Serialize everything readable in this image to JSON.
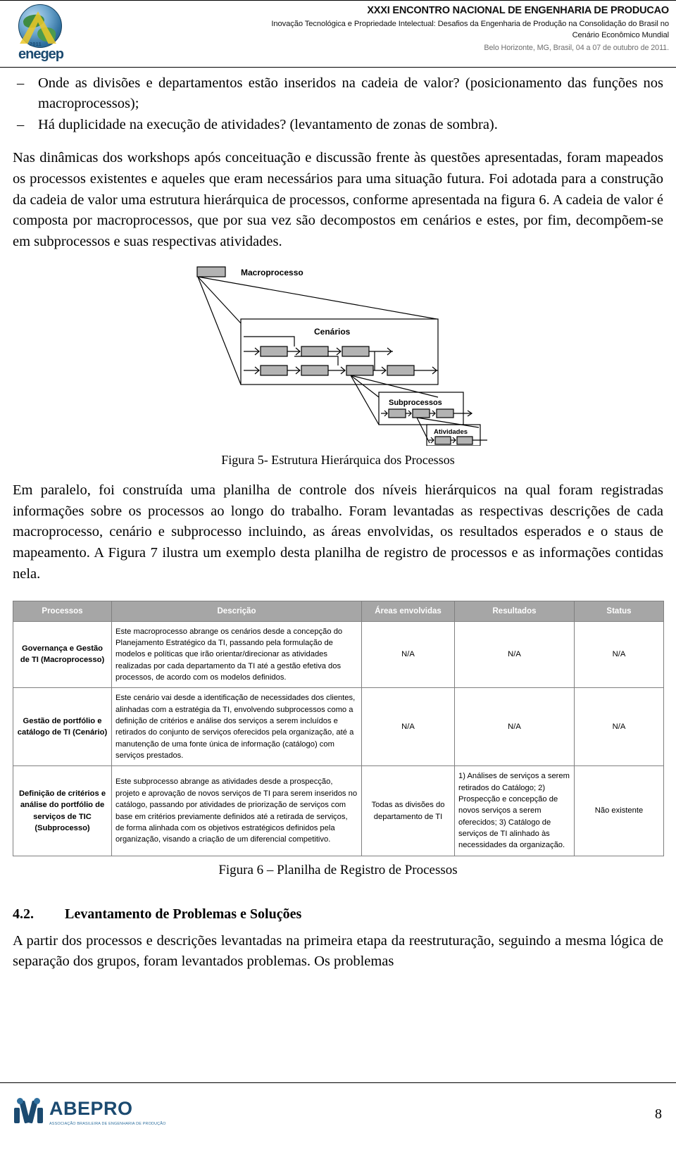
{
  "header": {
    "title": "XXXI ENCONTRO NACIONAL DE ENGENHARIA DE PRODUCAO",
    "subtitle": "Inovação Tecnológica e Propriedade Intelectual: Desafios da Engenharia de Produção na Consolidação do Brasil no",
    "subtitle2": "Cenário Econômico Mundial",
    "location": "Belo Horizonte, MG, Brasil, 04 a 07 de outubro de 2011.",
    "logo_word": "enegep",
    "logo_year": "2011"
  },
  "bullets": [
    "Onde as divisões e departamentos estão inseridos na cadeia de valor? (posicionamento das funções nos macroprocessos);",
    "Há duplicidade na execução de atividades? (levantamento de zonas de sombra)."
  ],
  "paragraph_1": "Nas dinâmicas dos workshops após conceituação e discussão frente às questões apresentadas, foram mapeados os processos existentes e aqueles que eram necessários para uma situação futura. Foi adotada para a construção da cadeia de valor uma estrutura hierárquica de processos, conforme apresentada na figura 6. A cadeia de valor é composta por macroprocessos, que por sua vez são decompostos em cenários e estes, por fim, decompõem-se em subprocessos e suas respectivas atividades.",
  "figure5": {
    "caption": "Figura 5- Estrutura Hierárquica dos Processos",
    "labels": {
      "macroprocesso": "Macroprocesso",
      "cenarios": "Cenários",
      "subprocessos": "Subprocessos",
      "atividades": "Atividades"
    }
  },
  "paragraph_2": "Em paralelo, foi construída uma planilha de controle dos níveis hierárquicos na qual foram registradas informações sobre os processos ao longo do trabalho. Foram levantadas as respectivas descrições de cada macroprocesso, cenário e subprocesso incluindo, as áreas envolvidas, os resultados esperados e o staus de mapeamento. A Figura 7 ilustra um exemplo desta planilha de registro de processos e as informações contidas nela.",
  "sheet": {
    "columns": [
      "Processos",
      "Descrição",
      "Áreas envolvidas",
      "Resultados",
      "Status"
    ],
    "rows": [
      {
        "processo": "Governança e Gestão de TI (Macroprocesso)",
        "descricao": "Este macroprocesso abrange os cenários desde a concepção do Planejamento Estratégico da TI, passando pela formulação de modelos e políticas que irão orientar/direcionar as atividades realizadas por cada departamento da TI até a gestão efetiva dos processos, de acordo com os modelos definidos.",
        "areas": "N/A",
        "resultados": "N/A",
        "status": "N/A"
      },
      {
        "processo": "Gestão de portfólio e catálogo de TI (Cenário)",
        "descricao": "Este cenário vai desde a identificação de necessidades dos clientes, alinhadas com a estratégia da TI, envolvendo subprocessos como a definição de critérios e análise dos serviços a serem incluídos e retirados do conjunto de serviços oferecidos pela organização, até a manutenção de uma fonte única de informação (catálogo) com serviços prestados.",
        "areas": "N/A",
        "resultados": "N/A",
        "status": "N/A"
      },
      {
        "processo": "Definição de critérios e análise do portfólio de serviços de TIC (Subprocesso)",
        "descricao": "Este subprocesso abrange as atividades desde a prospecção, projeto e aprovação de novos serviços de TI para serem inseridos no catálogo, passando por atividades de priorização de serviços com base em critérios previamente definidos até a retirada de serviços, de forma alinhada com os objetivos estratégicos definidos pela organização, visando a criação de um diferencial competitivo.",
        "areas": "Todas as divisões do departamento de TI",
        "resultados": "1) Análises de serviços a serem retirados do Catálogo; 2) Prospecção e concepção de novos serviços a serem oferecidos; 3) Catálogo de serviços de TI alinhado às necessidades da organização.",
        "status": "Não existente"
      }
    ],
    "caption": "Figura 6 – Planilha de Registro de Processos"
  },
  "section": {
    "number": "4.2.",
    "title": "Levantamento de Problemas e Soluções",
    "paragraph": "A partir dos processos e descrições levantadas na primeira etapa da reestruturação, seguindo a mesma lógica de separação dos grupos, foram levantados problemas. Os problemas"
  },
  "footer": {
    "brand": "ABEPRO",
    "tagline": "ASSOCIAÇÃO BRASILEIRA DE ENGENHARIA DE PRODUÇÃO",
    "page": "8"
  },
  "colors": {
    "header_bg": "#a6a6a6",
    "header_fg": "#ffffff",
    "grid": "#7f7f7f",
    "brand_blue": "#1b4a70",
    "muted": "#6d6d6d"
  }
}
